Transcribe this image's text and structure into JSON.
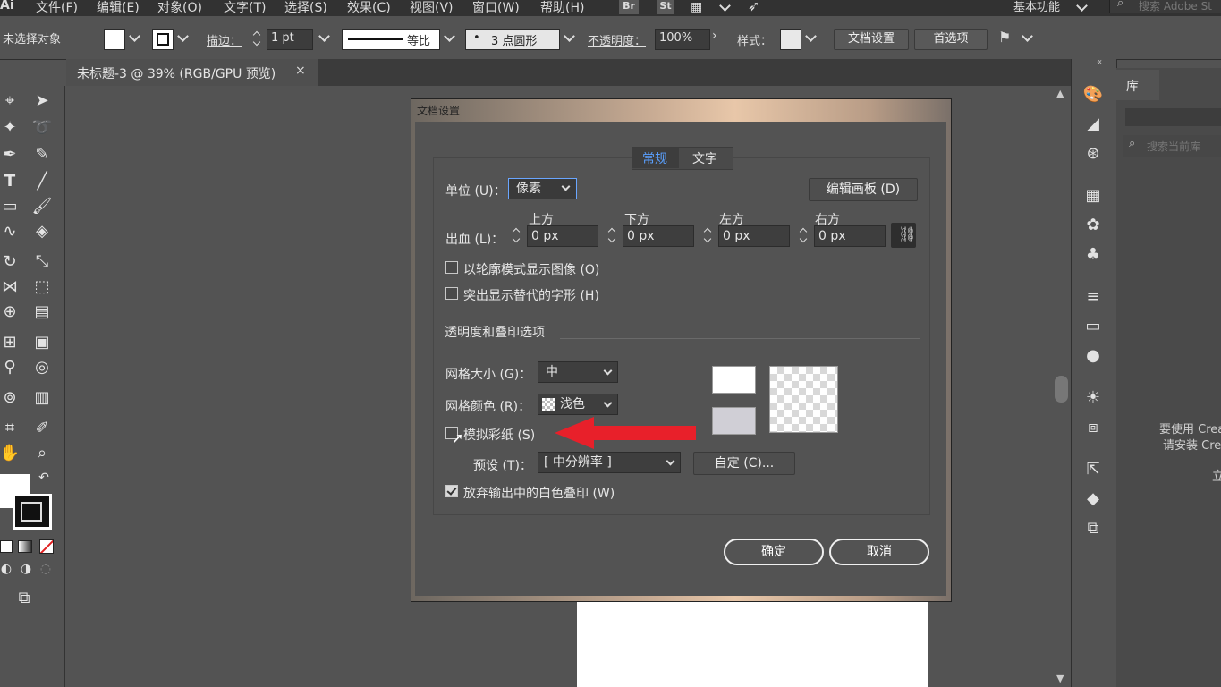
{
  "menubar": {
    "logo": "Ai",
    "items": [
      "文件(F)",
      "编辑(E)",
      "对象(O)",
      "文字(T)",
      "选择(S)",
      "效果(C)",
      "视图(V)",
      "窗口(W)",
      "帮助(H)"
    ],
    "app_icons": [
      "Br",
      "St"
    ],
    "workspace": "基本功能",
    "search_placeholder": "搜索 Adobe St"
  },
  "control_bar": {
    "selection_status": "未选择对象",
    "stroke_label": "描边：",
    "stroke_weight": "1 pt",
    "stroke_profile": "等比",
    "brush": "3 点圆形",
    "opacity_label": "不透明度：",
    "opacity_value": "100%",
    "style_label": "样式：",
    "doc_setup_button": "文档设置",
    "preferences_button": "首选项"
  },
  "document_tab": {
    "title": "未标题-3 @ 39% (RGB/GPU 预览)",
    "close": "×"
  },
  "library_panel": {
    "tab_label": "库",
    "search_placeholder": "搜索当前库",
    "message_line1": "要使用 Crea",
    "message_line2": "请安装 Crea",
    "edge_glyph": "立"
  },
  "dialog": {
    "title": "文档设置",
    "tabs": [
      "常规",
      "文字"
    ],
    "active_tab": "常规",
    "units_label": "单位 (U)：",
    "units_value": "像素",
    "edit_artboards_button": "编辑画板 (D)",
    "bleed_label": "出血 (L)：",
    "bleed": [
      {
        "side": "上方",
        "value": "0 px"
      },
      {
        "side": "下方",
        "value": "0 px"
      },
      {
        "side": "左方",
        "value": "0 px"
      },
      {
        "side": "右方",
        "value": "0 px"
      }
    ],
    "show_images_outline": {
      "label": "以轮廓模式显示图像 (O)",
      "checked": false
    },
    "highlight_glyphs": {
      "label": "突出显示替代的字形 (H)",
      "checked": false
    },
    "transparency_section": "透明度和叠印选项",
    "grid_size_label": "网格大小 (G)：",
    "grid_size_value": "中",
    "grid_color_label": "网格颜色 (R)：",
    "grid_color_value": "浅色",
    "simulate_paper": {
      "label": "模拟彩纸 (S)",
      "checked": false
    },
    "preset_label": "预设 (T)：",
    "preset_value": "[ 中分辨率 ]",
    "custom_button": "自定 (C)...",
    "discard_white_overprint": {
      "label": "放弃输出中的白色叠印 (W)",
      "checked": true
    },
    "ok_button": "确定",
    "cancel_button": "取消"
  },
  "colors": {
    "arrow": "#e8202a",
    "active_tab_text": "#5aa0ff"
  }
}
